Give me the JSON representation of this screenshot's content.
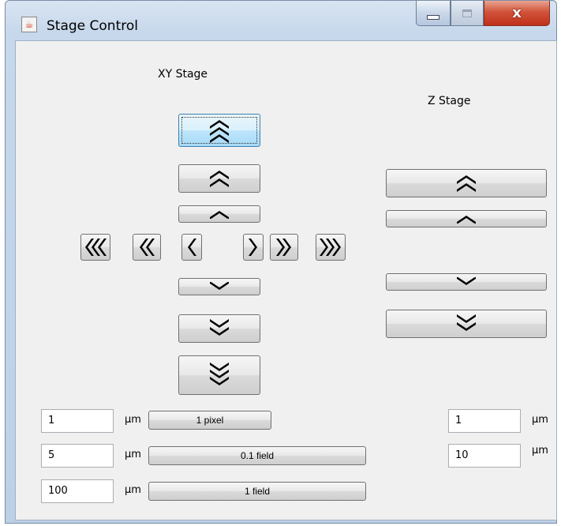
{
  "window": {
    "title": "Stage Control",
    "close_glyph": "x"
  },
  "xy_stage": {
    "title": "XY Stage"
  },
  "z_stage": {
    "title": "Z Stage"
  },
  "xy_steps": [
    {
      "value": "1",
      "unit": "µm",
      "button": "1 pixel"
    },
    {
      "value": "5",
      "unit": "µm",
      "button": "0.1 field"
    },
    {
      "value": "100",
      "unit": "µm",
      "button": "1 field"
    }
  ],
  "z_steps": [
    {
      "value": "1",
      "unit": "µm"
    },
    {
      "value": "10",
      "unit": "µm"
    }
  ],
  "icons": {
    "app": "java-icon",
    "minimize": "minimize-icon",
    "maximize": "maximize-icon",
    "close": "close-icon"
  }
}
